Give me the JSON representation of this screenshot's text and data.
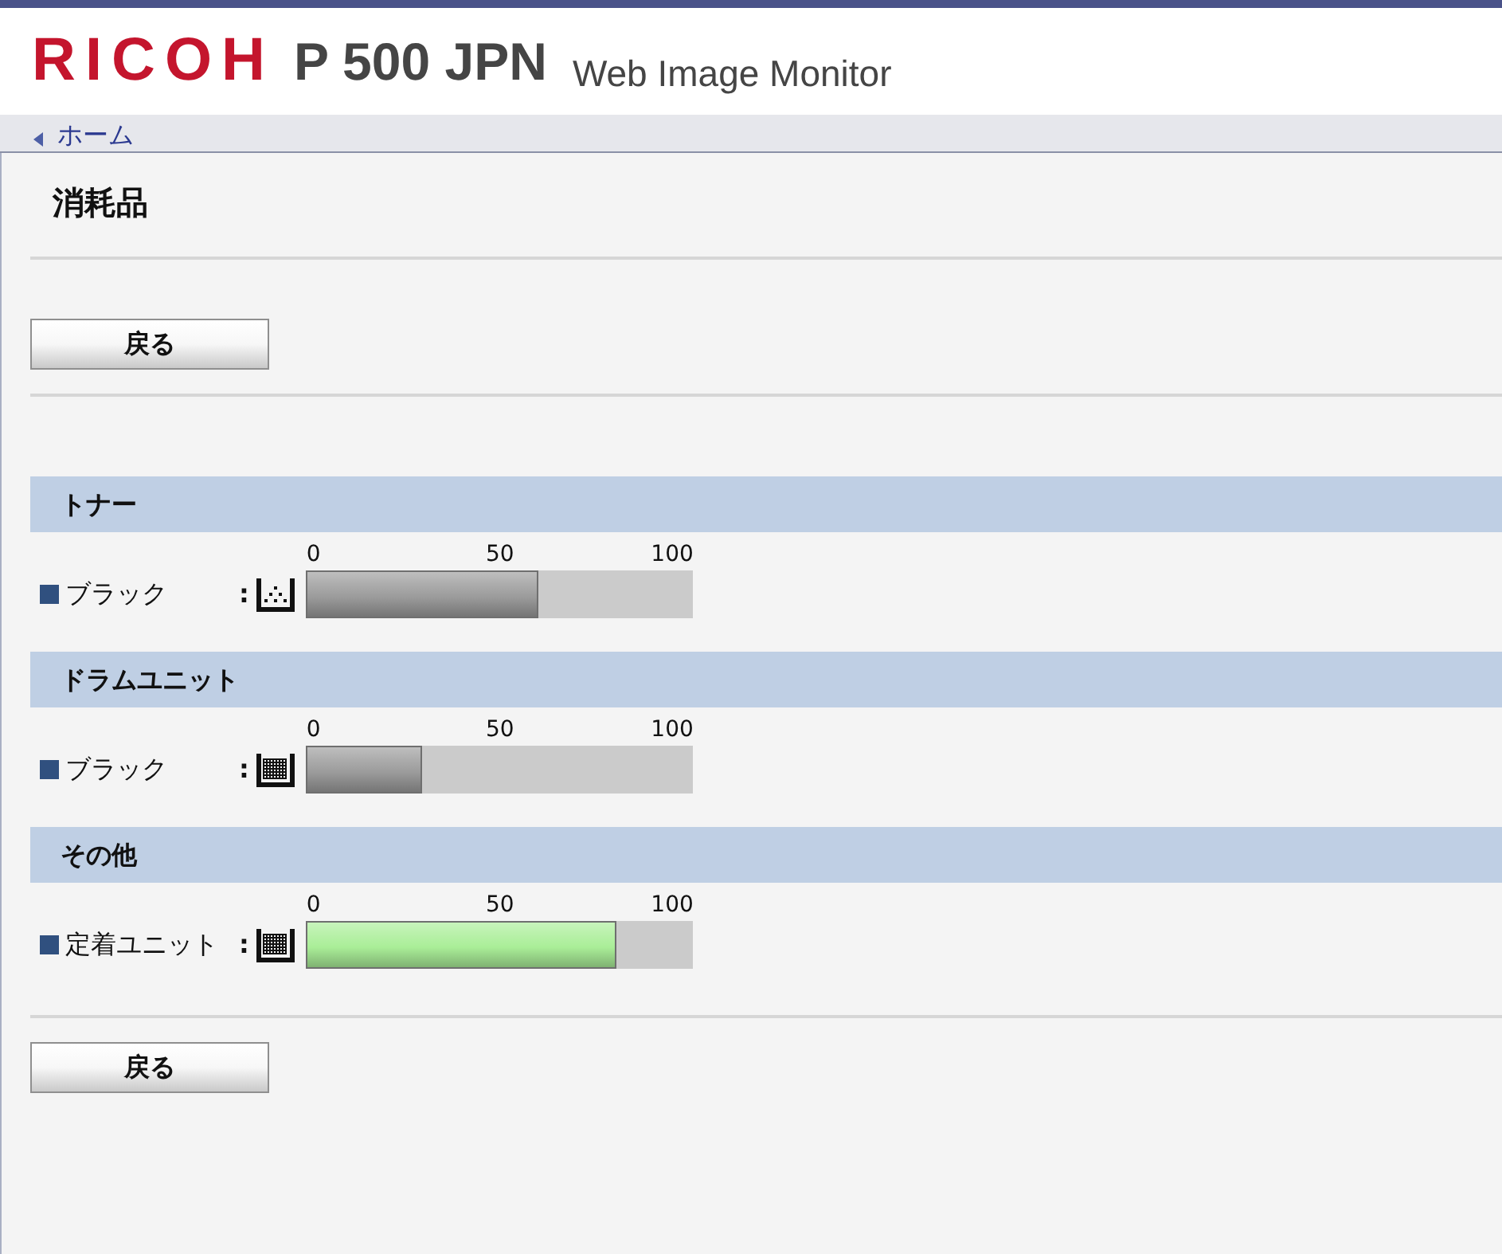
{
  "header": {
    "logo": "RICOH",
    "model": "P 500 JPN",
    "product": "Web Image Monitor"
  },
  "breadcrumb": {
    "label": "ホーム"
  },
  "page_title": "消耗品",
  "top_button": "戻る",
  "sections": [
    {
      "title": "トナー",
      "items": [
        {
          "kind": "toner",
          "label": "ブラック",
          "colon": ":",
          "ticks": [
            "0",
            "50",
            "100"
          ],
          "level": 0.6,
          "color": "#9c9c9c"
        }
      ]
    },
    {
      "title": "ドラムユニット",
      "items": [
        {
          "kind": "drum",
          "label": "ブラック",
          "colon": ":",
          "ticks": [
            "0",
            "50",
            "100"
          ],
          "level": 0.3,
          "color": "#9c9c9c"
        }
      ]
    },
    {
      "title": "その他",
      "items": [
        {
          "kind": "drum",
          "label": "定着ユニット",
          "colon": ":",
          "ticks": [
            "0",
            "50",
            "100"
          ],
          "level": 0.8,
          "color": "#aaee98"
        }
      ]
    }
  ],
  "bottom_button": "戻る"
}
